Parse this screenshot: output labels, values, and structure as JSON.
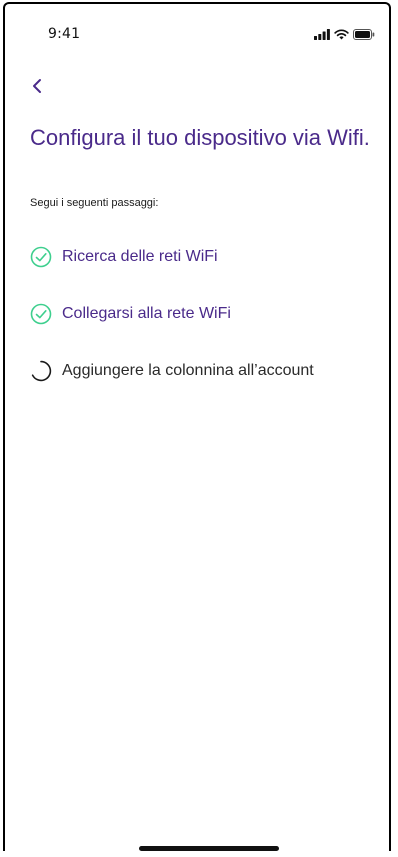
{
  "status_bar": {
    "time": "9:41",
    "icons": [
      "cellular-signal-icon",
      "wifi-icon",
      "battery-icon"
    ]
  },
  "header": {
    "back_icon": "chevron-left-icon"
  },
  "content": {
    "title": "Configura il tuo dispositivo via Wifi.",
    "subtitle": "Segui i seguenti passaggi:",
    "steps": [
      {
        "label": "Ricerca delle reti WiFi",
        "status": "done",
        "icon": "check-circle-icon"
      },
      {
        "label": "Collegarsi alla rete WiFi",
        "status": "done",
        "icon": "check-circle-icon"
      },
      {
        "label": "Aggiungere la colonnina all’account",
        "status": "in-progress",
        "icon": "spinner-icon"
      }
    ]
  },
  "colors": {
    "primary_text": "#4a2a8a",
    "success": "#3ecf8e",
    "body_text": "#2a2a2a"
  }
}
